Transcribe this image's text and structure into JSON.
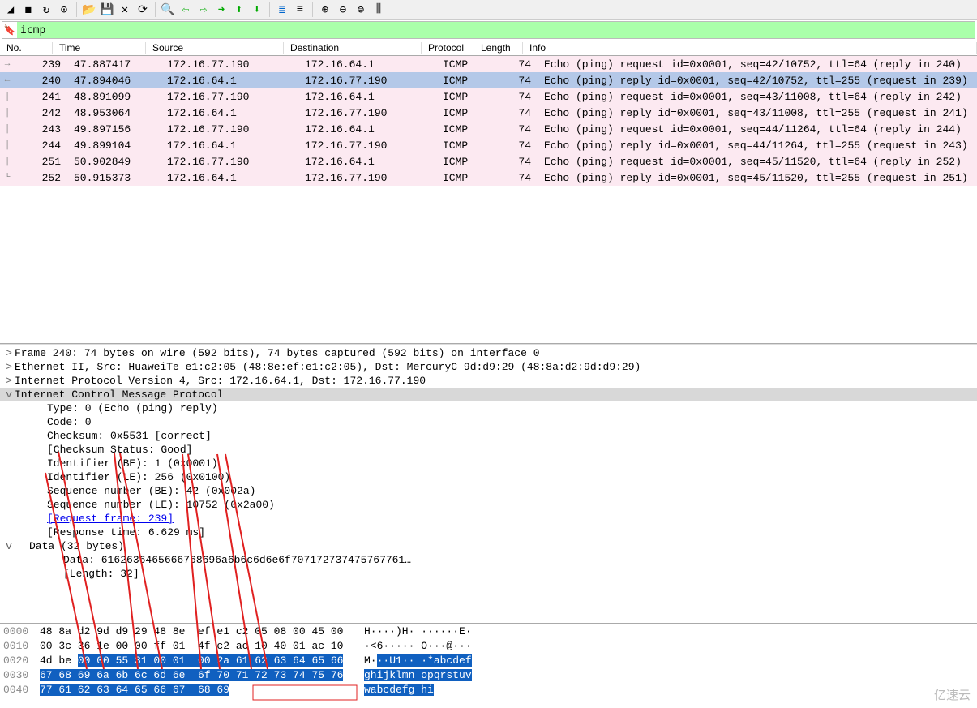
{
  "filter": {
    "value": "icmp"
  },
  "columns": {
    "no": "No.",
    "time": "Time",
    "source": "Source",
    "destination": "Destination",
    "protocol": "Protocol",
    "length": "Length",
    "info": "Info"
  },
  "packets": [
    {
      "no": "239",
      "time": "47.887417",
      "src": "172.16.77.190",
      "dst": "172.16.64.1",
      "proto": "ICMP",
      "len": "74",
      "info": "Echo (ping) request  id=0x0001, seq=42/10752, ttl=64 (reply in 240)",
      "sel": false
    },
    {
      "no": "240",
      "time": "47.894046",
      "src": "172.16.64.1",
      "dst": "172.16.77.190",
      "proto": "ICMP",
      "len": "74",
      "info": "Echo (ping) reply    id=0x0001, seq=42/10752, ttl=255 (request in 239)",
      "sel": true
    },
    {
      "no": "241",
      "time": "48.891099",
      "src": "172.16.77.190",
      "dst": "172.16.64.1",
      "proto": "ICMP",
      "len": "74",
      "info": "Echo (ping) request  id=0x0001, seq=43/11008, ttl=64 (reply in 242)",
      "sel": false
    },
    {
      "no": "242",
      "time": "48.953064",
      "src": "172.16.64.1",
      "dst": "172.16.77.190",
      "proto": "ICMP",
      "len": "74",
      "info": "Echo (ping) reply    id=0x0001, seq=43/11008, ttl=255 (request in 241)",
      "sel": false
    },
    {
      "no": "243",
      "time": "49.897156",
      "src": "172.16.77.190",
      "dst": "172.16.64.1",
      "proto": "ICMP",
      "len": "74",
      "info": "Echo (ping) request  id=0x0001, seq=44/11264, ttl=64 (reply in 244)",
      "sel": false
    },
    {
      "no": "244",
      "time": "49.899104",
      "src": "172.16.64.1",
      "dst": "172.16.77.190",
      "proto": "ICMP",
      "len": "74",
      "info": "Echo (ping) reply    id=0x0001, seq=44/11264, ttl=255 (request in 243)",
      "sel": false
    },
    {
      "no": "251",
      "time": "50.902849",
      "src": "172.16.77.190",
      "dst": "172.16.64.1",
      "proto": "ICMP",
      "len": "74",
      "info": "Echo (ping) request  id=0x0001, seq=45/11520, ttl=64 (reply in 252)",
      "sel": false
    },
    {
      "no": "252",
      "time": "50.915373",
      "src": "172.16.64.1",
      "dst": "172.16.77.190",
      "proto": "ICMP",
      "len": "74",
      "info": "Echo (ping) reply    id=0x0001, seq=45/11520, ttl=255 (request in 251)",
      "sel": false
    }
  ],
  "details": [
    {
      "caret": ">",
      "text": "Frame 240: 74 bytes on wire (592 bits), 74 bytes captured (592 bits) on interface 0",
      "indent": 0
    },
    {
      "caret": ">",
      "text": "Ethernet II, Src: HuaweiTe_e1:c2:05 (48:8e:ef:e1:c2:05), Dst: MercuryC_9d:d9:29 (48:8a:d2:9d:d9:29)",
      "indent": 0
    },
    {
      "caret": ">",
      "text": "Internet Protocol Version 4, Src: 172.16.64.1, Dst: 172.16.77.190",
      "indent": 0
    },
    {
      "caret": "v",
      "text": "Internet Control Message Protocol",
      "indent": 0,
      "hl": true
    },
    {
      "caret": "",
      "text": "Type: 0 (Echo (ping) reply)",
      "indent": 2
    },
    {
      "caret": "",
      "text": "Code: 0",
      "indent": 2
    },
    {
      "caret": "",
      "text": "Checksum: 0x5531 [correct]",
      "indent": 2
    },
    {
      "caret": "",
      "text": "[Checksum Status: Good]",
      "indent": 2
    },
    {
      "caret": "",
      "text": "Identifier (BE): 1 (0x0001)",
      "indent": 2
    },
    {
      "caret": "",
      "text": "Identifier (LE): 256 (0x0100)",
      "indent": 2
    },
    {
      "caret": "",
      "text": "Sequence number (BE): 42 (0x002a)",
      "indent": 2
    },
    {
      "caret": "",
      "text": "Sequence number (LE): 10752 (0x2a00)",
      "indent": 2
    },
    {
      "caret": "",
      "text": "[Request frame: 239]",
      "indent": 2,
      "link": true
    },
    {
      "caret": "",
      "text": "[Response time: 6.629 ms]",
      "indent": 2
    },
    {
      "caret": "v",
      "text": "Data (32 bytes)",
      "indent": 1
    },
    {
      "caret": "",
      "text": "Data: 6162636465666768696a6b6c6d6e6f707172737475767761…",
      "indent": 3
    },
    {
      "caret": "",
      "text": "[Length: 32]",
      "indent": 3
    }
  ],
  "hex": [
    {
      "off": "0000",
      "bytes": "48 8a d2 9d d9 29 48 8e  ef e1 c2 05 08 00 45 00",
      "ascii": "H····)H· ······E·",
      "selStart": null
    },
    {
      "off": "0010",
      "bytes": "00 3c 36 1e 00 00 ff 01  4f c2 ac 10 40 01 ac 10",
      "ascii": "·<6····· O···@···",
      "selStart": null
    },
    {
      "off": "0020",
      "bytes": "4d be 00 00 55 31 00 01  00 2a 61 62 63 64 65 66",
      "ascii": "M···U1·· ·*abcdef",
      "selStart": 2
    },
    {
      "off": "0030",
      "bytes": "67 68 69 6a 6b 6c 6d 6e  6f 70 71 72 73 74 75 76",
      "ascii": "ghijklmn opqrstuv",
      "selStart": 0
    },
    {
      "off": "0040",
      "bytes": "77 61 62 63 64 65 66 67  68 69",
      "ascii": "wabcdefg hi",
      "selStart": 0
    }
  ],
  "watermark": "亿速云"
}
